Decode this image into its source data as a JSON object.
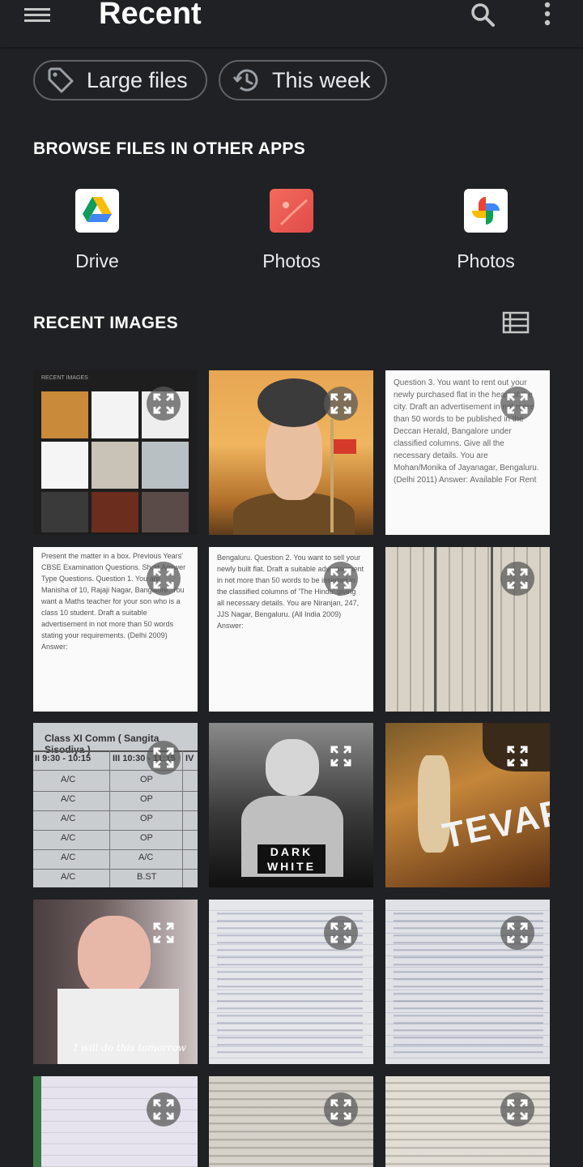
{
  "header": {
    "title": "Recent"
  },
  "filters": [
    {
      "label": "Large files",
      "icon": "tag-icon"
    },
    {
      "label": "This week",
      "icon": "history-icon"
    }
  ],
  "browse": {
    "heading": "BROWSE FILES IN OTHER APPS",
    "apps": [
      {
        "label": "Drive",
        "icon": "google-drive-icon"
      },
      {
        "label": "Photos",
        "icon": "gallery-photos-icon"
      },
      {
        "label": "Photos",
        "icon": "google-photos-icon"
      }
    ]
  },
  "recent": {
    "heading": "RECENT IMAGES",
    "images": [
      {
        "kind": "screenshot",
        "text": "RECENT IMAGES"
      },
      {
        "kind": "photo",
        "text": ""
      },
      {
        "kind": "document",
        "text": "Question 3. You want to rent out your newly purchased flat in the heart of the city. Draft an advertisement in not more than 50 words to be published in the Deccan Herald, Bangalore under classified columns. Give all the necessary details. You are Mohan/Monika of Jayanagar, Bengaluru. (Delhi 2011) Answer: Available For Rent"
      },
      {
        "kind": "document",
        "text": "Present the matter in a box. Previous Years' CBSE Examination Questions. Short Answer Type Questions. Question 1. You are Manisha of 10, Rajaji Nagar, Bangalore. You want a Maths teacher for your son who is a class 10 student. Draft a suitable advertisement in not more than 50 words stating your requirements. (Delhi 2009) Answer:"
      },
      {
        "kind": "document",
        "text": "Bengaluru. Question 2. You want to sell your newly built flat. Draft a suitable advertisement in not more than 50 words to be inserted in the classified columns of 'The Hindu' giving all necessary details. You are Niranjan, 247, JJS Nagar, Bengaluru. (All India 2009) Answer:"
      },
      {
        "kind": "book",
        "text": ""
      },
      {
        "kind": "table",
        "text": "Class XI Comm ( Sangita Sisodiya )",
        "cells": [
          "II 9:30 - 10:15",
          "III 10:30 - 11:15",
          "IV",
          "A/C",
          "OP",
          "A/C",
          "OP",
          "A/C",
          "OP",
          "A/C",
          "OP",
          "A/C",
          "A/C",
          "A/C",
          "B.ST"
        ]
      },
      {
        "kind": "poster",
        "text": "DARK WHITE"
      },
      {
        "kind": "poster",
        "text": "TEVAR"
      },
      {
        "kind": "selfie",
        "text": "I will do this tomorrow"
      },
      {
        "kind": "notes",
        "text": ""
      },
      {
        "kind": "notes",
        "text": ""
      },
      {
        "kind": "notes",
        "text": ""
      },
      {
        "kind": "notes",
        "text": ""
      },
      {
        "kind": "book",
        "text": ""
      }
    ]
  },
  "colors": {
    "background": "#202124",
    "chip_border": "#5f6368",
    "text": "#e8eaed"
  }
}
